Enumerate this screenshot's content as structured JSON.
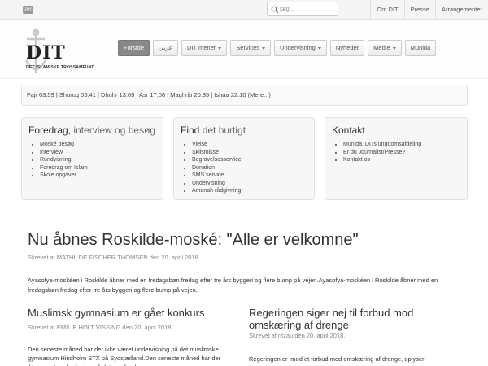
{
  "topbar": {
    "lang_badge": "AR",
    "search": {
      "placeholder": "søg..."
    },
    "links": [
      "Om DIT",
      "Presse",
      "Arrangementer"
    ]
  },
  "logo": {
    "name": "DIT",
    "subtitle": "DET ISLAMISKE TROSSAMFUND"
  },
  "nav": {
    "items": [
      {
        "label": "Forside",
        "active": true,
        "dropdown": false
      },
      {
        "label": "عربي",
        "active": false,
        "dropdown": false
      },
      {
        "label": "DIT mener",
        "active": false,
        "dropdown": true
      },
      {
        "label": "Services",
        "active": false,
        "dropdown": true
      },
      {
        "label": "Undervisning",
        "active": false,
        "dropdown": true
      },
      {
        "label": "Nyheder",
        "active": false,
        "dropdown": false
      },
      {
        "label": "Medie",
        "active": false,
        "dropdown": true
      },
      {
        "label": "Munida",
        "active": false,
        "dropdown": false
      }
    ]
  },
  "prayer_times": "Fajr 03:59 | Shuruq 05:41 | Dhuhr 13:09 | Asr 17:08 | Maghrib 20:35 | Ishaa 22:10 (Mere...)",
  "boxes": {
    "foredrag": {
      "title": "Foredrag,",
      "title_accent": "interview og besøg",
      "items": [
        "Moské besøg",
        "Interview",
        "Rundvisning",
        "Foredrag om Islam",
        "Skole opgaver"
      ]
    },
    "find": {
      "title": "Find",
      "title_accent": "det hurtigt",
      "items": [
        "Vielse",
        "Skilsmisse",
        "Begravelsesservice",
        "Donation",
        "SMS service",
        "Undervisning",
        "Amanah rådgivning"
      ]
    },
    "kontakt": {
      "title": "Kontakt",
      "items": [
        "Munida, DITs ungdomsafdeling",
        "Er du Journalist/Presse?",
        "Kontakt os"
      ]
    }
  },
  "main_article": {
    "title": "Nu åbnes Roskilde-moské: \"Alle er velkomne\"",
    "byline": "Skrevet af MATHILDE FISCHER THOMSEN den 20. april 2018.",
    "body": "Ayasofya-moskéen i Roskilde åbner med en fredagsbøn fredag efter tre års byggeri og flere bump på vejen.Ayasofya-moskéen i Roskilde åbner med en fredagsbøn fredag efter tre års byggeri og flere bump på vejen."
  },
  "articles": [
    {
      "title": "Muslimsk gymnasium er gået konkurs",
      "byline": "Skrevet af EMILIE HOLT VISSING den 20. april 2018.",
      "body": "Den seneste måned har der ikke været undervisning på det muslimske gymnasium Hindholm STX på Sydsjælland.Den seneste måned har der ikke været undervisning på det muslimske"
    },
    {
      "title": "Regeringen siger nej til forbud mod omskæring af drenge",
      "byline": "Skrevet af ritzau den 20. april 2018.",
      "body": "Regeringen er imod et forbud mod omskæring af drenge, oplyser"
    }
  ]
}
